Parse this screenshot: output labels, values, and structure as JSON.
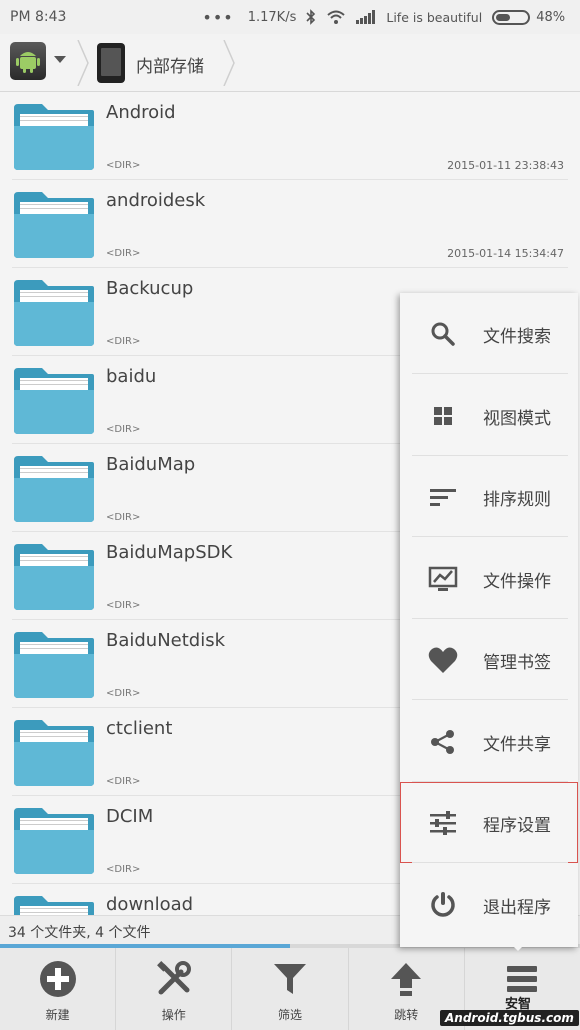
{
  "status": {
    "time": "PM 8:43",
    "dots": "•••",
    "speed": "1.17K/s",
    "carrier": "Life is beautiful",
    "battery": "48%"
  },
  "path": {
    "location": "内部存储"
  },
  "files": [
    {
      "name": "Android",
      "type": "<DIR>",
      "date": "2015-01-11 23:38:43"
    },
    {
      "name": "androidesk",
      "type": "<DIR>",
      "date": "2015-01-14 15:34:47"
    },
    {
      "name": "Backucup",
      "type": "<DIR>",
      "date": ""
    },
    {
      "name": "baidu",
      "type": "<DIR>",
      "date": ""
    },
    {
      "name": "BaiduMap",
      "type": "<DIR>",
      "date": ""
    },
    {
      "name": "BaiduMapSDK",
      "type": "<DIR>",
      "date": ""
    },
    {
      "name": "BaiduNetdisk",
      "type": "<DIR>",
      "date": ""
    },
    {
      "name": "ctclient",
      "type": "<DIR>",
      "date": ""
    },
    {
      "name": "DCIM",
      "type": "<DIR>",
      "date": ""
    },
    {
      "name": "download",
      "type": "",
      "date": ""
    }
  ],
  "summary": "34 个文件夹, 4 个文件",
  "menu": [
    {
      "label": "文件搜索",
      "icon": "search-icon"
    },
    {
      "label": "视图模式",
      "icon": "grid-icon"
    },
    {
      "label": "排序规则",
      "icon": "sort-icon"
    },
    {
      "label": "文件操作",
      "icon": "chart-icon"
    },
    {
      "label": "管理书签",
      "icon": "heart-icon"
    },
    {
      "label": "文件共享",
      "icon": "share-icon"
    },
    {
      "label": "程序设置",
      "icon": "sliders-icon"
    },
    {
      "label": "退出程序",
      "icon": "power-icon"
    }
  ],
  "toolbar": [
    {
      "label": "新建",
      "icon": "plus-icon"
    },
    {
      "label": "操作",
      "icon": "tools-icon"
    },
    {
      "label": "筛选",
      "icon": "filter-icon"
    },
    {
      "label": "跳转",
      "icon": "arrow-up-icon"
    },
    {
      "label": "",
      "icon": "menu-icon"
    }
  ],
  "watermark": "Android.tgbus.com",
  "watermark_top": "安智",
  "colors": {
    "folder": "#5fb8d6",
    "folder_dark": "#3c9bbd",
    "accent_progress": "#5aa7d6",
    "menu_selected_border": "#d9534f"
  }
}
